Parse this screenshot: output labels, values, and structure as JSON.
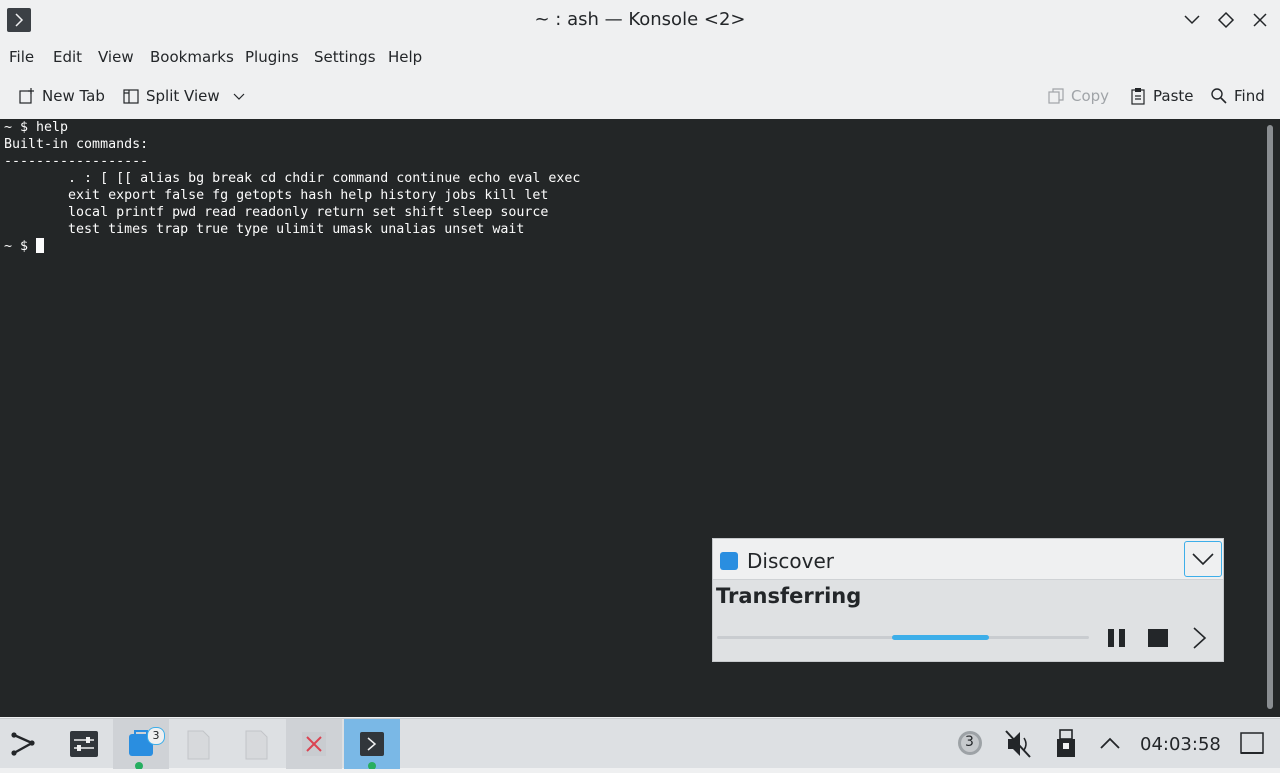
{
  "window": {
    "title": "~ : ash — Konsole <2>"
  },
  "menubar": {
    "items": [
      "File",
      "Edit",
      "View",
      "Bookmarks",
      "Plugins",
      "Settings",
      "Help"
    ]
  },
  "toolbar": {
    "new_tab": "New Tab",
    "split_view": "Split View",
    "copy": "Copy",
    "paste": "Paste",
    "find": "Find"
  },
  "terminal": {
    "lines": [
      "~ $ help",
      "Built-in commands:",
      "------------------",
      "        . : [ [[ alias bg break cd chdir command continue echo eval exec",
      "        exit export false fg getopts hash help history jobs kill let",
      "        local printf pwd read readonly return set shift sleep source",
      "        test times trap true type ulimit umask unalias unset wait",
      ""
    ],
    "prompt": "~ $ "
  },
  "notification": {
    "app": "Discover",
    "status": "Transferring",
    "progress_start": 0.47,
    "progress_end": 0.73
  },
  "taskbar": {
    "discover_badge": "3",
    "tray_notification_count": "3",
    "clock": "04:03:58"
  },
  "colors": {
    "terminal_bg": "#232627",
    "terminal_fg": "#fcfcfc",
    "accent": "#3daee9",
    "taskbar_active": "#7ab8e6"
  }
}
